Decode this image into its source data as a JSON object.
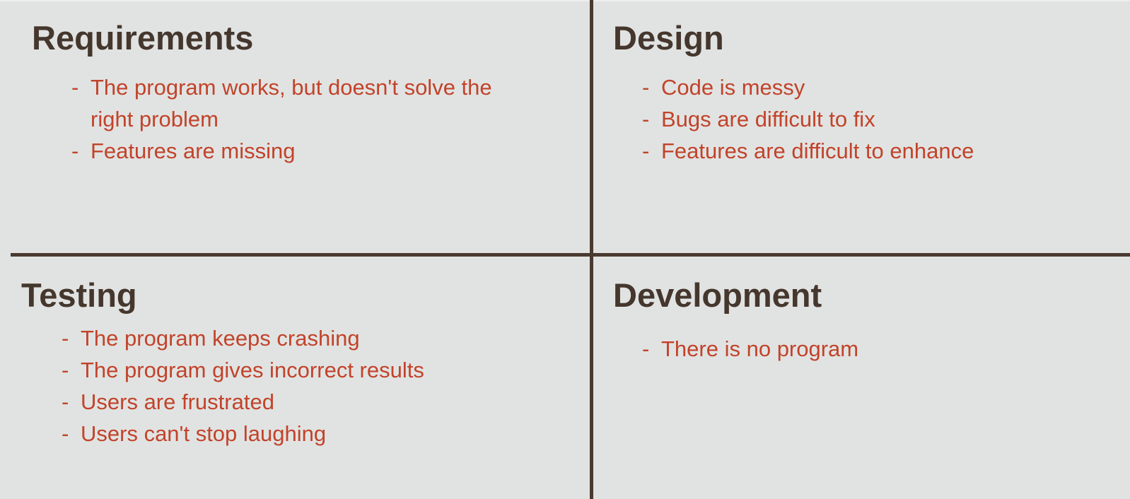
{
  "quadrants": [
    {
      "title": "Requirements",
      "items": [
        "The program works, but doesn't solve the right problem",
        "Features are missing"
      ]
    },
    {
      "title": "Design",
      "items": [
        "Code is messy",
        "Bugs are difficult to fix",
        "Features are difficult to enhance"
      ]
    },
    {
      "title": "Testing",
      "items": [
        "The program keeps crashing",
        "The program gives incorrect results",
        "Users are frustrated",
        "Users can't stop laughing"
      ]
    },
    {
      "title": "Development",
      "items": [
        "There is no program"
      ]
    }
  ],
  "bullet": "-",
  "colors": {
    "background": "#e1e3e2",
    "divider": "#4a3a30",
    "heading": "#45372d",
    "item_text": "#c2432a"
  }
}
